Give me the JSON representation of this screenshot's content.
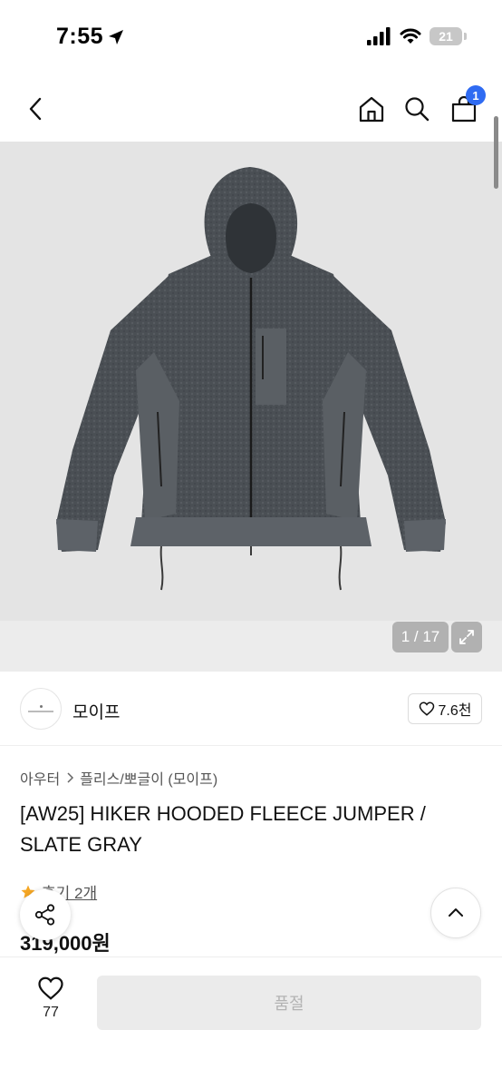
{
  "status_bar": {
    "time": "7:55",
    "battery": "21",
    "icons": [
      "location-arrow-icon",
      "signal-icon",
      "wifi-icon",
      "battery-icon"
    ]
  },
  "nav": {
    "icons": [
      "chevron-left-icon",
      "home-icon",
      "search-icon",
      "cart-icon"
    ],
    "cart_count": "1"
  },
  "gallery": {
    "image": "slate gray hooded fleece jumper",
    "page": "1 / 17",
    "expand_icon": "expand-icon"
  },
  "brand": {
    "name": "모이프",
    "likes": "7.6천"
  },
  "product": {
    "breadcrumb": [
      "아우터",
      "플리스/뽀글이 (모이프)"
    ],
    "title": "[AW25] HIKER HOODED FLEECE JUMPER / SLATE GRAY",
    "review_link": "후기 2개",
    "price": "319,000원"
  },
  "bottom": {
    "wish_count": "77",
    "soldout_label": "품절"
  },
  "colors": {
    "accent": "#2f6bf2",
    "star": "#f5a623",
    "disabled_bg": "#ebebeb",
    "disabled_text": "#b3b3b3"
  }
}
